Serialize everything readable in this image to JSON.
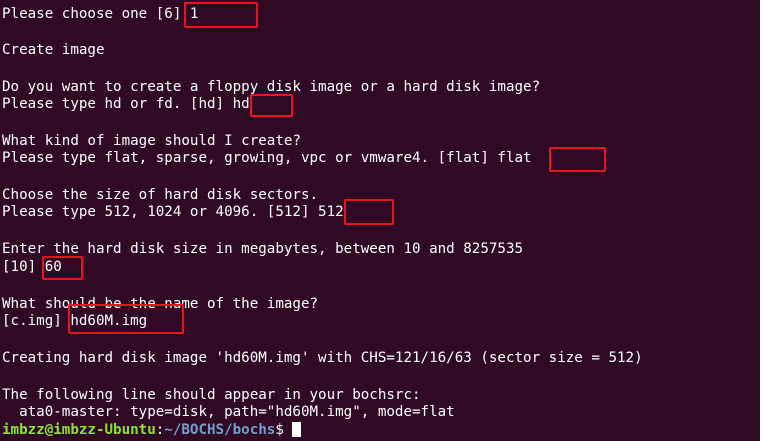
{
  "terminal": {
    "background_color": "#300a24",
    "text_color": "#ffffff",
    "highlight_color": "#e8141e",
    "lines": [
      {
        "prefix": "Please choose one [6]",
        "answer": " 1"
      },
      {
        "text": "Create image"
      },
      {
        "text": "Do you want to create a floppy disk image or a hard disk image?"
      },
      {
        "prefix": "Please type hd or fd. [hd]",
        "answer": " hd"
      },
      {
        "text": "What kind of image should I create?"
      },
      {
        "prefix": "Please type flat, sparse, growing, vpc or vmware4. [flat]",
        "answer": " flat"
      },
      {
        "text": "Choose the size of hard disk sectors."
      },
      {
        "prefix": "Please type 512, 1024 or 4096. [512]",
        "answer": " 512"
      },
      {
        "text": "Enter the hard disk size in megabytes, between 10 and 8257535"
      },
      {
        "prefix": "[10]",
        "answer": " 60"
      },
      {
        "text": "What should be the name of the image?"
      },
      {
        "prefix": "[c.img]",
        "answer": " hd60M.img"
      },
      {
        "text": "Creating hard disk image 'hd60M.img' with CHS=121/16/63 (sector size = 512)"
      },
      {
        "text": "The following line should appear in your bochsrc:"
      },
      {
        "text": "  ata0-master: type=disk, path=\"hd60M.img\", mode=flat"
      }
    ],
    "prompt": {
      "user_host": "imbzz@imbzz-Ubuntu",
      "separator": ":",
      "path": "~/BOCHS/bochs",
      "symbol": "$ "
    }
  }
}
